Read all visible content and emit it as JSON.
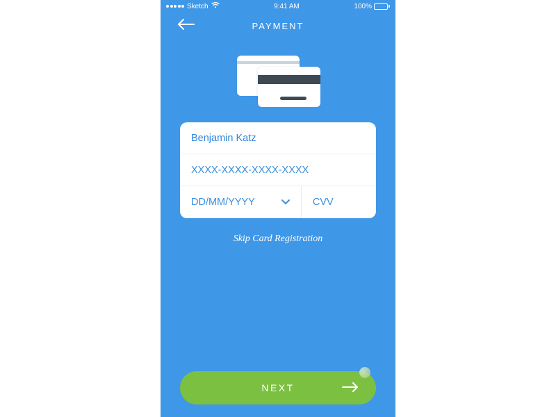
{
  "statusbar": {
    "carrier": "Sketch",
    "time": "9:41 AM",
    "battery": "100%"
  },
  "header": {
    "title": "PAYMENT"
  },
  "form": {
    "name_value": "Benjamin Katz",
    "card_placeholder": "XXXX-XXXX-XXXX-XXXX",
    "expiry_placeholder": "DD/MM/YYYY",
    "cvv_placeholder": "CVV"
  },
  "skip_label": "Skip Card Registration",
  "next_label": "NEXT"
}
